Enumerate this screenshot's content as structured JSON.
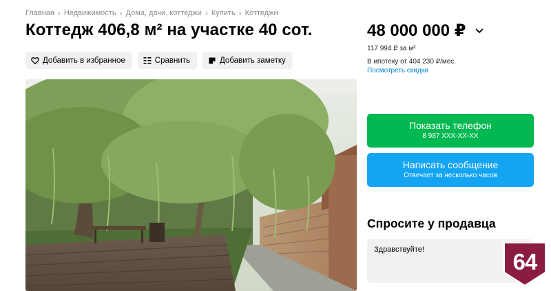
{
  "breadcrumbs": [
    "Главная",
    "Недвижимость",
    "Дома, дачи, коттеджи",
    "Купить",
    "Коттеджи"
  ],
  "title": "Коттедж 406,8 м² на участке 40 сот.",
  "actions": {
    "favorite": "Добавить в избранное",
    "compare": "Сравнить",
    "note": "Добавить заметку"
  },
  "price": {
    "value": "48 000 000 ₽",
    "per_m2": "117 994 ₽ за м²",
    "mortgage": "В ипотеку от 404 230 ₽/мес.",
    "discounts_link": "Посмотреть скидки"
  },
  "contact": {
    "phone_label": "Показать телефон",
    "phone_number": "8 987 XXX-XX-XX",
    "message_label": "Написать сообщение",
    "message_sub": "Отвечает за несколько часов"
  },
  "ask": {
    "title": "Спросите у продавца",
    "message": "Здравствуйте!"
  },
  "badge": {
    "text": "64",
    "color": "#8a1d3f"
  },
  "colors": {
    "green": "#02b951",
    "blue": "#13a4f2",
    "link": "#0a88d8",
    "chip_bg": "#f2f1f0"
  }
}
